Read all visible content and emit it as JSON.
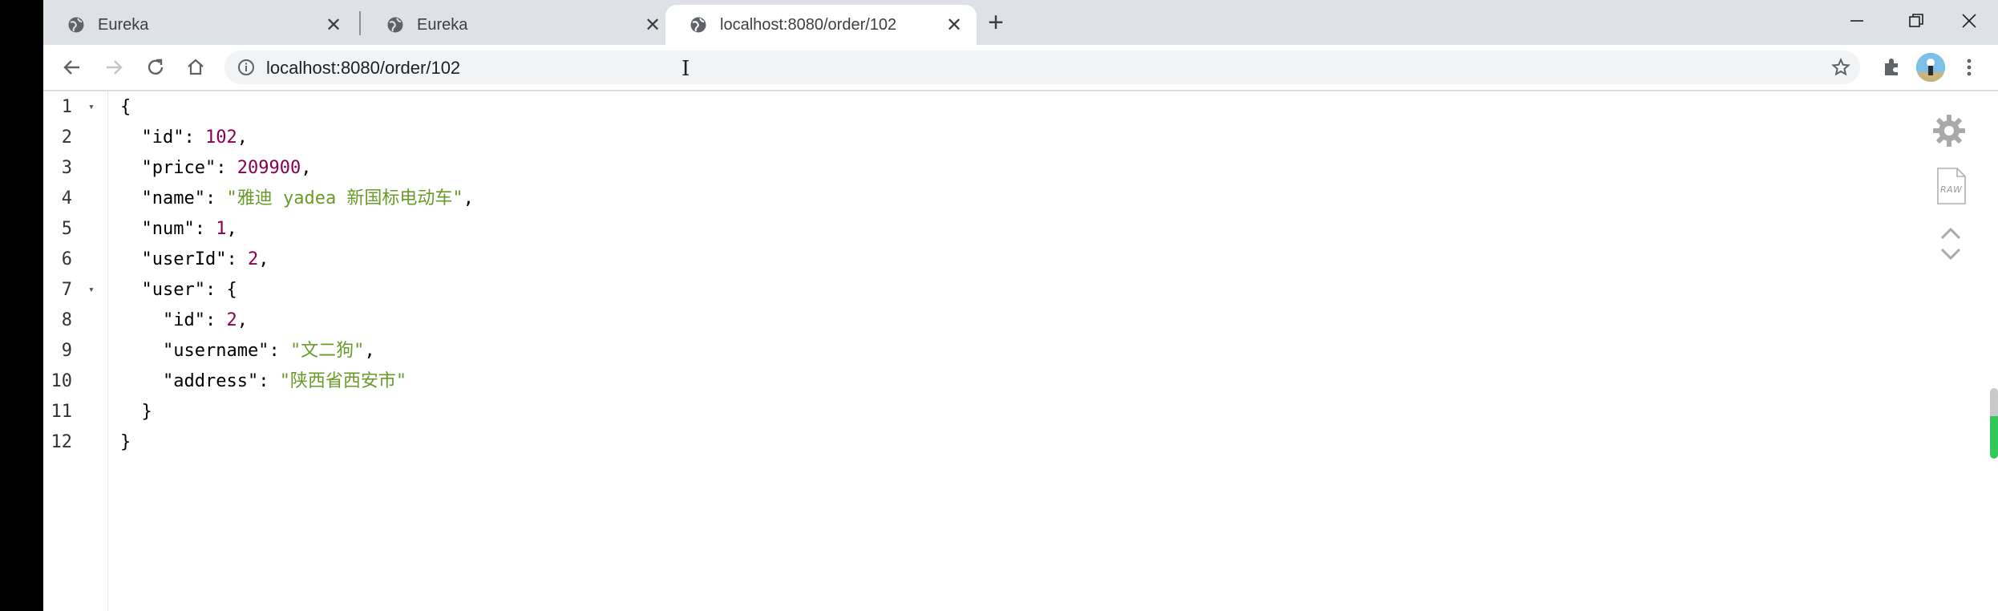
{
  "tabs": [
    {
      "title": "Eureka",
      "active": false
    },
    {
      "title": "Eureka",
      "active": false
    },
    {
      "title": "localhost:8080/order/102",
      "active": true
    }
  ],
  "new_tab_label": "+",
  "address_bar": {
    "url": "localhost:8080/order/102"
  },
  "json_lines": [
    {
      "num": "1",
      "fold": "▾",
      "tokens": [
        {
          "t": "{",
          "c": "p"
        }
      ]
    },
    {
      "num": "2",
      "fold": "",
      "tokens": [
        {
          "t": "  \"id\"",
          "c": "k"
        },
        {
          "t": ": ",
          "c": "p"
        },
        {
          "t": "102",
          "c": "n"
        },
        {
          "t": ",",
          "c": "p"
        }
      ]
    },
    {
      "num": "3",
      "fold": "",
      "tokens": [
        {
          "t": "  \"price\"",
          "c": "k"
        },
        {
          "t": ": ",
          "c": "p"
        },
        {
          "t": "209900",
          "c": "n"
        },
        {
          "t": ",",
          "c": "p"
        }
      ]
    },
    {
      "num": "4",
      "fold": "",
      "tokens": [
        {
          "t": "  \"name\"",
          "c": "k"
        },
        {
          "t": ": ",
          "c": "p"
        },
        {
          "t": "\"雅迪 yadea 新国标电动车\"",
          "c": "s"
        },
        {
          "t": ",",
          "c": "p"
        }
      ]
    },
    {
      "num": "5",
      "fold": "",
      "tokens": [
        {
          "t": "  \"num\"",
          "c": "k"
        },
        {
          "t": ": ",
          "c": "p"
        },
        {
          "t": "1",
          "c": "n"
        },
        {
          "t": ",",
          "c": "p"
        }
      ]
    },
    {
      "num": "6",
      "fold": "",
      "tokens": [
        {
          "t": "  \"userId\"",
          "c": "k"
        },
        {
          "t": ": ",
          "c": "p"
        },
        {
          "t": "2",
          "c": "n"
        },
        {
          "t": ",",
          "c": "p"
        }
      ]
    },
    {
      "num": "7",
      "fold": "▾",
      "tokens": [
        {
          "t": "  \"user\"",
          "c": "k"
        },
        {
          "t": ": {",
          "c": "p"
        }
      ]
    },
    {
      "num": "8",
      "fold": "",
      "tokens": [
        {
          "t": "    \"id\"",
          "c": "k"
        },
        {
          "t": ": ",
          "c": "p"
        },
        {
          "t": "2",
          "c": "n"
        },
        {
          "t": ",",
          "c": "p"
        }
      ]
    },
    {
      "num": "9",
      "fold": "",
      "tokens": [
        {
          "t": "    \"username\"",
          "c": "k"
        },
        {
          "t": ": ",
          "c": "p"
        },
        {
          "t": "\"文二狗\"",
          "c": "s"
        },
        {
          "t": ",",
          "c": "p"
        }
      ]
    },
    {
      "num": "10",
      "fold": "",
      "tokens": [
        {
          "t": "    \"address\"",
          "c": "k"
        },
        {
          "t": ": ",
          "c": "p"
        },
        {
          "t": "\"陕西省西安市\"",
          "c": "s"
        }
      ]
    },
    {
      "num": "11",
      "fold": "",
      "tokens": [
        {
          "t": "  }",
          "c": "p"
        }
      ]
    },
    {
      "num": "12",
      "fold": "",
      "tokens": [
        {
          "t": "}",
          "c": "p"
        }
      ]
    }
  ],
  "viewer_tools": {
    "raw_label": "RAW"
  },
  "colors": {
    "key": "#000000",
    "number": "#8a0050",
    "string": "#6a9a2a",
    "scroll_accent": "#34c759"
  }
}
